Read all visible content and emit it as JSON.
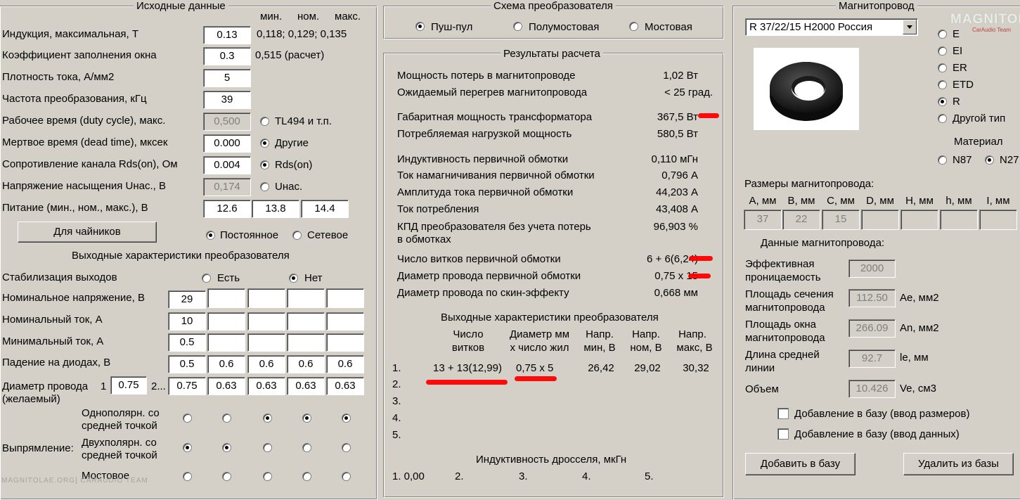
{
  "input": {
    "title": "Исходные данные",
    "col_min": "мин.",
    "col_nom": "ном.",
    "col_max": "макс.",
    "induction_label": "Индукция, максимальная, Т",
    "induction_value": "0.13",
    "induction_range": "0,118; 0,129; 0,135",
    "fill_label": "Коэффициент заполнения окна",
    "fill_value": "0.3",
    "fill_calc": "0,515 (расчет)",
    "current_density_label": "Плотность тока, А/мм2",
    "current_density_value": "5",
    "frequency_label": "Частота преобразования, кГц",
    "frequency_value": "39",
    "duty_label": "Рабочее время (duty cycle), макс.",
    "duty_value": "0,500",
    "tl494_label": "TL494 и т.п.",
    "dead_label": "Мертвое время (dead time), мксек",
    "dead_value": "0.000",
    "other_label": "Другие",
    "rds_label": "Сопротивление канала Rds(on), Ом",
    "rds_value": "0.004",
    "rds_opt_label": "Rds(on)",
    "usat_label": "Напряжение насыщения Uнас., В",
    "usat_value": "0,174",
    "usat_opt_label": "Uнас.",
    "supply_label": "Питание (мин., ном., макс.), В",
    "supply_min": "12.6",
    "supply_nom": "13.8",
    "supply_max": "14.4",
    "dummies_button": "Для чайников",
    "const_label": "Постоянное",
    "network_label": "Сетевое"
  },
  "output": {
    "title": "Выходные характеристики преобразователя",
    "stab_label": "Стабилизация выходов",
    "stab_yes": "Есть",
    "stab_no": "Нет",
    "voltage_label": "Номинальное напряжение, В",
    "voltage_values": [
      "29",
      "",
      "",
      "",
      ""
    ],
    "current_label": "Номинальный ток, А",
    "current_values": [
      "10",
      "",
      "",
      "",
      ""
    ],
    "min_current_label": "Минимальный ток, А",
    "min_current_values": [
      "0.5",
      "",
      "",
      "",
      ""
    ],
    "diode_label": "Падение на диодах, В",
    "diode_values": [
      "0.5",
      "0.6",
      "0.6",
      "0.6",
      "0.6"
    ],
    "wire_label": "Диаметр провода",
    "wire_label2": "(желаемый)",
    "wire_one": "1",
    "wire_primary": "0.75",
    "wire_two": "2...",
    "wire_values": [
      "0.75",
      "0.63",
      "0.63",
      "0.63",
      "0.63"
    ],
    "rectifier_label": "Выпрямление:",
    "rect_uni": "Однополярн. со\nсредней точкой",
    "rect_uni_l1": "Однополярн. со",
    "rect_uni_l2": "средней точкой",
    "rect_bi_l1": "Двухполярн. со",
    "rect_bi_l2": "средней точкой",
    "rect_bridge": "Мостовое",
    "watermark": "MAGNITOLAE.ORG] CARAUDIO TEAM"
  },
  "scheme": {
    "title": "Схема преобразователя",
    "push_pull": "Пуш-пул",
    "half_bridge": "Полумостовая",
    "bridge": "Мостовая"
  },
  "results": {
    "title": "Результаты расчета",
    "rows": [
      {
        "label": "Мощность потерь в магнитопроводе",
        "value": "1,02 Вт"
      },
      {
        "label": "Ожидаемый перегрев магнитопровода",
        "value": "< 25 град."
      },
      {
        "label": "Габаритная мощность трансформатора",
        "value": "367,5 Вт"
      },
      {
        "label": "Потребляемая нагрузкой мощность",
        "value": "580,5 Вт"
      },
      {
        "label": "Индуктивность первичной обмотки",
        "value": "0,110 мГн"
      },
      {
        "label": "Ток намагничивания первичной обмотки",
        "value": "0,796 А"
      },
      {
        "label": "Амплитуда тока первичной обмотки",
        "value": "44,203 А"
      },
      {
        "label": "Ток потребления",
        "value": "43,408 А"
      },
      {
        "label": "КПД преобразователя без учета потерь",
        "value": "96,903 %"
      },
      {
        "label": "в обмотках",
        "value": ""
      },
      {
        "label": "Число витков первичной обмотки",
        "value": "6 + 6(6,24)"
      },
      {
        "label": "Диаметр провода первичной обмотки",
        "value": "0,75 x 15"
      },
      {
        "label": "Диаметр провода по скин-эффекту",
        "value": "0,668 мм"
      }
    ],
    "out_title": "Выходные характеристики преобразователя",
    "hdr_turns_1": "Число",
    "hdr_turns_2": "витков",
    "hdr_diam_1": "Диаметр мм",
    "hdr_diam_2": "x число жил",
    "hdr_umin_1": "Напр.",
    "hdr_umin_2": "мин, В",
    "hdr_unom_1": "Напр.",
    "hdr_unom_2": "ном, В",
    "hdr_umax_1": "Напр.",
    "hdr_umax_2": "макс, В",
    "out_rows": [
      {
        "n": "1.",
        "turns": "13 + 13(12,99)",
        "diam": "0,75 x 5",
        "umin": "26,42",
        "unom": "29,02",
        "umax": "30,32"
      },
      {
        "n": "2.",
        "turns": "",
        "diam": "",
        "umin": "",
        "unom": "",
        "umax": ""
      },
      {
        "n": "3.",
        "turns": "",
        "diam": "",
        "umin": "",
        "unom": "",
        "umax": ""
      },
      {
        "n": "4.",
        "turns": "",
        "diam": "",
        "umin": "",
        "unom": "",
        "umax": ""
      },
      {
        "n": "5.",
        "turns": "",
        "diam": "",
        "umin": "",
        "unom": "",
        "umax": ""
      }
    ],
    "choke_title": "Индуктивность дросселя, мкГн",
    "choke": [
      "1. 0,00",
      "2.",
      "3.",
      "4.",
      "5."
    ]
  },
  "core": {
    "title": "Магнитопровод",
    "selected": "R 37/22/15 H2000 Россия",
    "logo": "MAGNITOLA",
    "logo_sub": "CarAudio Team",
    "types": [
      "E",
      "EI",
      "ER",
      "ETD",
      "R",
      "Другой тип"
    ],
    "material_label": "Материал",
    "mat_n87": "N87",
    "mat_n27": "N27",
    "dims_label": "Размеры магнитопровода:",
    "dim_headers": [
      "A, мм",
      "B, мм",
      "C, мм",
      "D, мм",
      "H, мм",
      "h, мм",
      "I, мм"
    ],
    "dim_values": [
      "37",
      "22",
      "15",
      "",
      "",
      "",
      ""
    ],
    "data_label": "Данные магнитопровода:",
    "perm_l1": "Эффективная",
    "perm_l2": "проницаемость",
    "perm_value": "2000",
    "area_l1": "Площадь сечения",
    "area_l2": "магнитопровода",
    "area_value": "112.50",
    "area_unit": "Ae, мм2",
    "window_l1": "Площадь окна",
    "window_l2": "магнитопровода",
    "window_value": "266.09",
    "window_unit": "An, мм2",
    "len_l1": "Длина средней",
    "len_l2": "линии",
    "len_value": "92.7",
    "len_unit": "le, мм",
    "vol_label": "Объем",
    "vol_value": "10.426",
    "vol_unit": "Ve, см3",
    "add_dims": "Добавление в базу (ввод размеров)",
    "add_data": "Добавление в базу (ввод данных)",
    "add_button": "Добавить в базу",
    "delete_button": "Удалить из базы"
  },
  "colors": {
    "background": "#d4d0c8",
    "scribble": "#ff0000"
  }
}
